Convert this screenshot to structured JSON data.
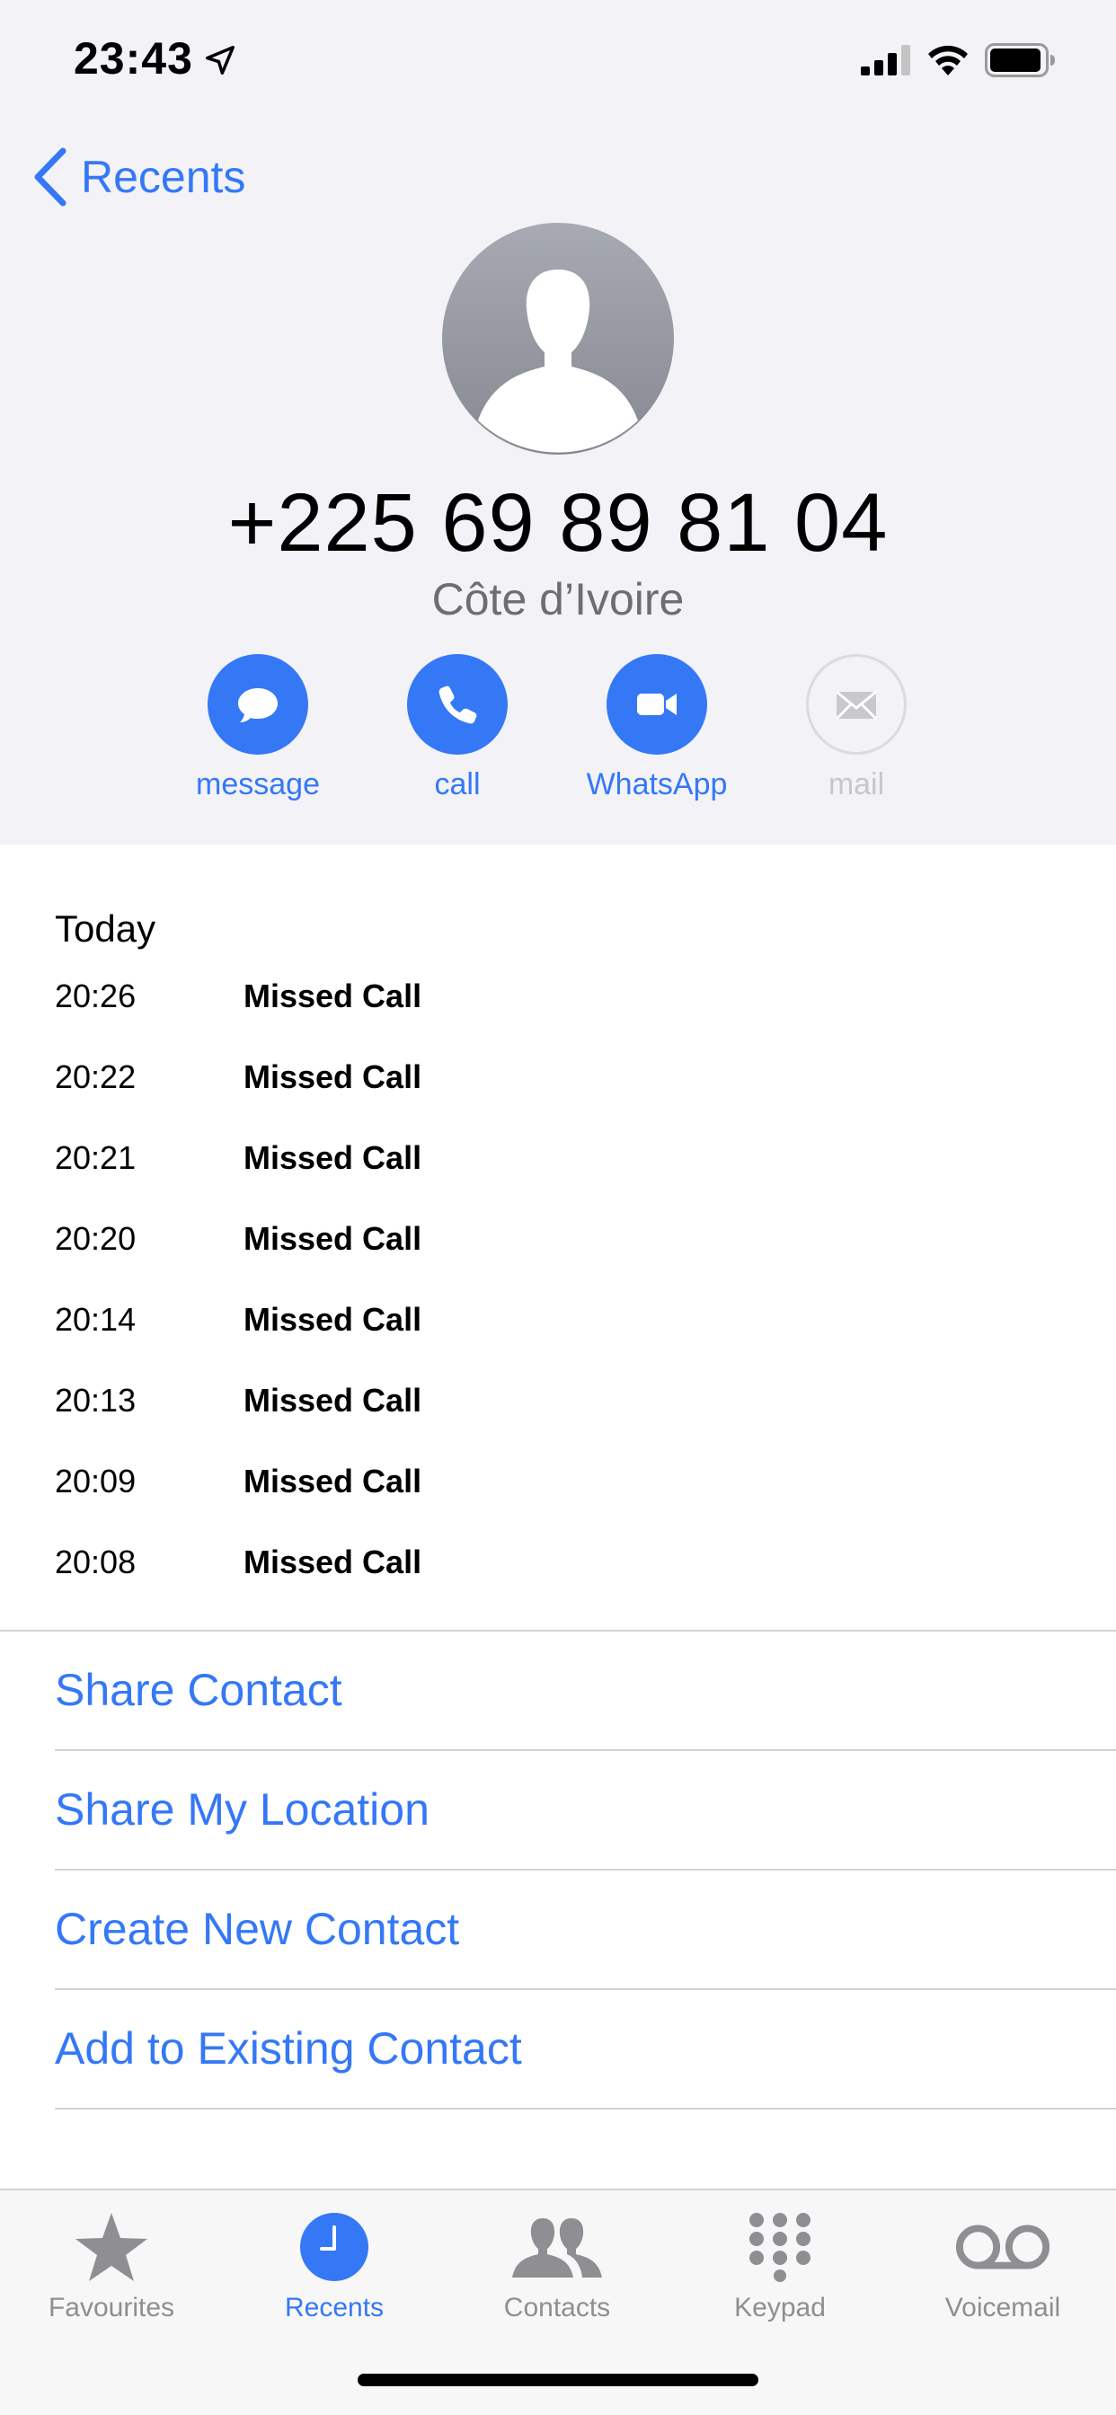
{
  "status_bar": {
    "time": "23:43"
  },
  "nav": {
    "back_label": "Recents"
  },
  "contact": {
    "phone_number": "+225 69 89 81 04",
    "country": "Côte d’Ivoire"
  },
  "actions": [
    {
      "label": "message",
      "icon": "message-icon",
      "enabled": true
    },
    {
      "label": "call",
      "icon": "phone-icon",
      "enabled": true
    },
    {
      "label": "WhatsApp",
      "icon": "video-icon",
      "enabled": true
    },
    {
      "label": "mail",
      "icon": "mail-icon",
      "enabled": false
    }
  ],
  "history": {
    "heading": "Today",
    "rows": [
      {
        "time": "20:26",
        "type": "Missed Call"
      },
      {
        "time": "20:22",
        "type": "Missed Call"
      },
      {
        "time": "20:21",
        "type": "Missed Call"
      },
      {
        "time": "20:20",
        "type": "Missed Call"
      },
      {
        "time": "20:14",
        "type": "Missed Call"
      },
      {
        "time": "20:13",
        "type": "Missed Call"
      },
      {
        "time": "20:09",
        "type": "Missed Call"
      },
      {
        "time": "20:08",
        "type": "Missed Call"
      }
    ]
  },
  "options": [
    {
      "label": "Share Contact"
    },
    {
      "label": "Share My Location"
    },
    {
      "label": "Create New Contact"
    },
    {
      "label": "Add to Existing Contact"
    }
  ],
  "tabbar": {
    "active": "Recents",
    "tabs": [
      {
        "label": "Favourites",
        "icon": "star-icon"
      },
      {
        "label": "Recents",
        "icon": "clock-icon"
      },
      {
        "label": "Contacts",
        "icon": "contacts-icon"
      },
      {
        "label": "Keypad",
        "icon": "keypad-icon"
      },
      {
        "label": "Voicemail",
        "icon": "voicemail-icon"
      }
    ]
  },
  "colors": {
    "accent": "#3478f6",
    "header_bg": "#f2f2f7",
    "separator": "#d1d1d6",
    "secondary_text": "#6d6d72",
    "inactive_tab": "#8e8e93"
  }
}
